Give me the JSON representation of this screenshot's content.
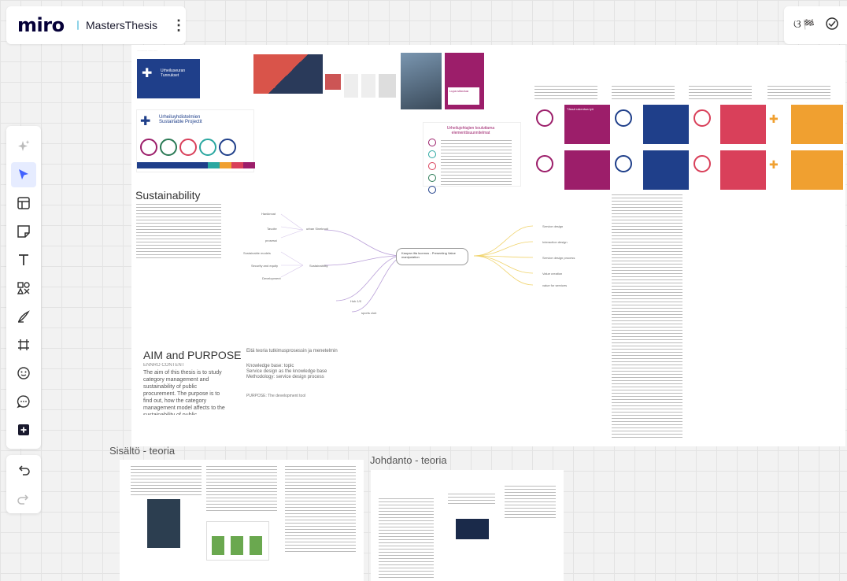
{
  "app": {
    "logo": "miro",
    "board_name": "MastersThesis"
  },
  "toolbar": {
    "tools": [
      "ai-assist",
      "select",
      "templates",
      "sticky-note",
      "text",
      "shapes",
      "pen",
      "frame",
      "sticker",
      "comment",
      "more-apps"
    ],
    "undo": "undo",
    "redo": "redo"
  },
  "canvas": {
    "frames": {
      "main_headings": {
        "sustainability": "Sustainability",
        "aim": "AIM and PURPOSE"
      },
      "aim_text": {
        "intro": "ENNRO CONTENT",
        "body": "The aim of this thesis is to study category management and sustainability of public procurement. The purpose is to find out, how the category management model affects to the sustainability of public procurement. In this ..."
      },
      "theory_text": {
        "line1": "Eitä teoria tutkimusprosessin ja menetelmin",
        "line2": "Knowledge base: topic",
        "line3": "Service design as the knowledge base",
        "line4": "Methodology: service design process",
        "purpose": "PURPOSE: The development tool"
      },
      "mindmap": {
        "center": "Kaupan ilta luonnos - Presenting Value manipulation",
        "left_nodes": [
          "Hankinnat",
          "Tavoite",
          "prosessi",
          "Sustainable models",
          "Security and equity",
          "Development",
          "Hub 1/0",
          "sports club"
        ],
        "mid_nodes": [
          "urban Sineknoti",
          "Sustainability"
        ],
        "right_nodes": [
          "Service design",
          "Interaction design",
          "Service design process",
          "Value creation",
          "value for services"
        ]
      },
      "cards": {
        "blue_card": "Urheiluseuran Tunnukset",
        "blue_card2": "Urheiluyhdistelmien Sustainable Projectit",
        "purple_card": "Tässä rakentaa työ",
        "circle_card_title": "Urheilujohtajien kouluttama elementtisuunnitelmat"
      }
    },
    "section_labels": {
      "sisalto": "Sisältö - teoria",
      "johdanto": "Johdanto - teoria"
    }
  },
  "colors": {
    "accent": "#4262ff",
    "navy": "#1f3f8a",
    "magenta": "#9c1e6a",
    "red": "#d9405a",
    "orange": "#f0a030",
    "teal": "#2aa7a0"
  }
}
